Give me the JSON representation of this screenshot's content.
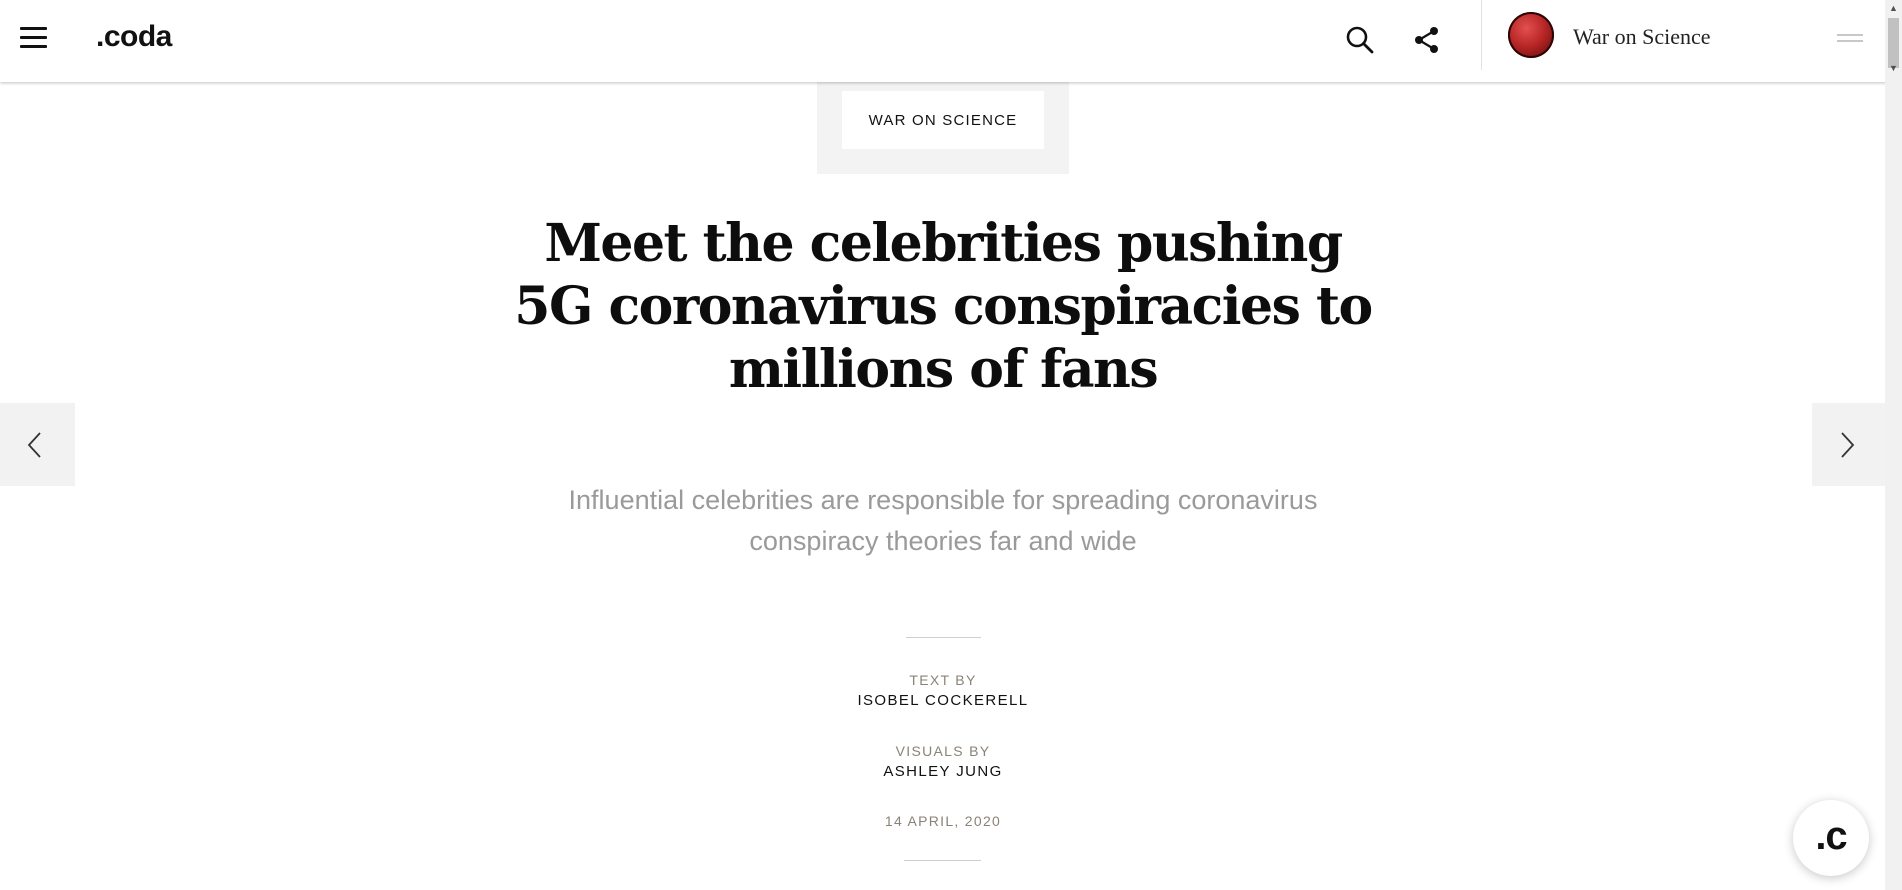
{
  "header": {
    "logo": ".coda",
    "series_title": "War on Science",
    "icons": {
      "menu": "hamburger-menu-icon",
      "search": "search-icon",
      "share": "share-icon",
      "series_badge": "coronavirus-badge-icon",
      "collapse": "double-line-handle-icon"
    }
  },
  "article": {
    "category": "WAR ON SCIENCE",
    "headline": "Meet the celebrities pushing 5G coronavirus conspiracies to millions of fans",
    "dek": "Influential celebrities are responsible for spreading coronavirus conspiracy theories far and wide",
    "credits": {
      "text_label": "TEXT BY",
      "text_name": "ISOBEL COCKERELL",
      "visuals_label": "VISUALS BY",
      "visuals_name": "ASHLEY JUNG"
    },
    "date": "14 APRIL, 2020"
  },
  "navigation": {
    "prev_icon": "chevron-left-icon",
    "next_icon": "chevron-right-icon"
  },
  "fab": {
    "label": ".c"
  },
  "colors": {
    "text": "#111111",
    "dek": "#9a9a9a",
    "credit_label": "#8a8378",
    "panel_gray": "#f2f2f2"
  }
}
